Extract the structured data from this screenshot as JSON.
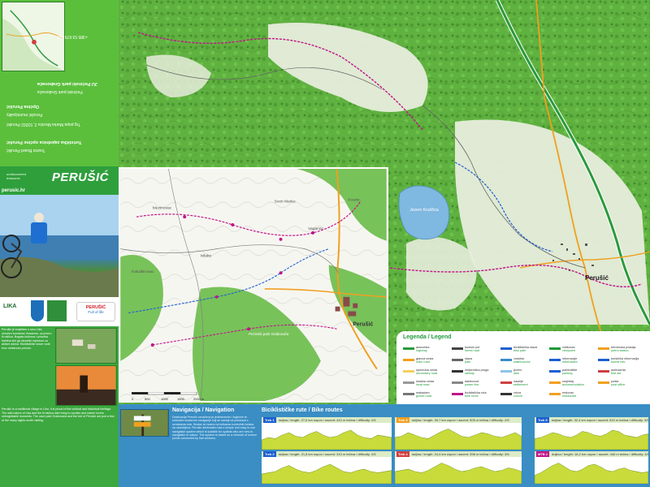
{
  "map": {
    "town_label": "Perušić",
    "lake_label": "Jezero Kruščica",
    "inset_town_label": "Perušić",
    "inset_places": [
      "Sveti Marko",
      "Kvarte",
      "Mezinovac",
      "Kaluđerovac",
      "Vaganac",
      "Mlaka"
    ],
    "inset_poi_label": "Pećinski park Grabovača"
  },
  "left_panel": {
    "brand": "PERUŠIĆ",
    "brand_sub": "undiscovered treasures",
    "url": "perusic.hr",
    "tourist_board": "Turistička zajednica općine Perušić",
    "tourist_board_en": "Tourist Board Perušić",
    "municipality": "Općina Perušić",
    "municipality_en": "Perušić municipality",
    "address": "Trg popa Marka Mesića 2, 53202 Perušić",
    "phone": "+385 53 679 188",
    "cave_park": "JU Pećinski park Grabovača",
    "cave_park_en": "Pećinski park Grabovača",
    "logo_1": "LIKA",
    "logo_2": "PERUŠIĆ",
    "logo_3_sub": "Full of life",
    "para_top": "Perušić je smješten u srcu Like, okružen šumama i livadama, uz jezero Kruščica. Bogata kulturna i prirodna baština čini ga idealnim mjestom za aktivni odmor. Biciklističke staze vode kroz netaknutu prirodu.",
    "para_bottom": "Perušić is a traditional village in Lika. It is proud of the cultural and historical heritage. The wild nature of Lika and the Kruščica lake bring to cyclists and nature lovers unforgettable moments. The cave park Grabovača and the fort of Perušić are just a few of the many sights worth visiting."
  },
  "legend": {
    "title": "Legenda / Legend",
    "items": [
      {
        "hr": "autocesta",
        "en": "highway",
        "color": "#2a9a3a"
      },
      {
        "hr": "glavna cesta",
        "en": "main road",
        "color": "#f0a020"
      },
      {
        "hr": "sporedna cesta",
        "en": "secondary road",
        "color": "#f5d060"
      },
      {
        "hr": "lokalna cesta",
        "en": "local road",
        "color": "#999999"
      },
      {
        "hr": "makadam",
        "en": "gravel road",
        "color": "#777777"
      },
      {
        "hr": "šumski put",
        "en": "forest road",
        "color": "#444444"
      },
      {
        "hr": "staza",
        "en": "path",
        "color": "#666666"
      },
      {
        "hr": "željeznička pruga",
        "en": "railway",
        "color": "#333333"
      },
      {
        "hr": "dalekovod",
        "en": "power line",
        "color": "#888888"
      },
      {
        "hr": "biciklistička ruta",
        "en": "bike route",
        "color": "#c0148a"
      },
      {
        "hr": "biciklistička staza",
        "en": "bike path",
        "color": "#1e5fd0"
      },
      {
        "hr": "vodotok",
        "en": "watercourse",
        "color": "#3a8ec4"
      },
      {
        "hr": "jezero",
        "en": "lake",
        "color": "#8fc3e6"
      },
      {
        "hr": "naselje",
        "en": "settlement",
        "color": "#d04040"
      },
      {
        "hr": "crkva",
        "en": "church",
        "color": "#333333"
      },
      {
        "hr": "vidikovac",
        "en": "viewpoint",
        "color": "#1d9a3a"
      },
      {
        "hr": "informacije",
        "en": "information",
        "color": "#1e5fd0"
      },
      {
        "hr": "parkiralište",
        "en": "parking",
        "color": "#1e5fd0"
      },
      {
        "hr": "smještaj",
        "en": "accommodation",
        "color": "#f0a020"
      },
      {
        "hr": "restoran",
        "en": "restaurant",
        "color": "#f0a020"
      },
      {
        "hr": "benzinska postaja",
        "en": "petrol station",
        "color": "#f0a020"
      },
      {
        "hr": "turistička informacija",
        "en": "tourist info",
        "color": "#1e5fd0"
      },
      {
        "hr": "ambulanta",
        "en": "first aid",
        "color": "#d04040"
      },
      {
        "hr": "pošta",
        "en": "post office",
        "color": "#f0a020"
      }
    ]
  },
  "navigation": {
    "title": "Navigacija / Navigation",
    "text": "Destinacija Perušić označena je jedinstvenim i logičnim te sloboden sustavom navigacije koji se sastoji od putokaza s oznakama ruta. Sustav se bazira na točkama kontrolnih točaka na raskrižjima. Perušić destination has a simple and easy to use navigation system which is suitable for cyclists who are new to navigation in nature. The system is based on a network of control points connected by trail sections."
  },
  "bike_routes": {
    "title": "Biciklističke rute / Bike routes",
    "tracks": [
      {
        "label": "Trek 1",
        "header": "duljina / length: 27,6 km  uspon / ascent: 410 m  težina / difficulty: 2/5",
        "color": "#1e5fd0",
        "profile": [
          0.4,
          0.5,
          0.45,
          0.6,
          0.7,
          0.55,
          0.5,
          0.65,
          0.75,
          0.6,
          0.5,
          0.55,
          0.7,
          0.8,
          0.6,
          0.5,
          0.45,
          0.6,
          0.55,
          0.5
        ]
      },
      {
        "label": "Trek 3",
        "header": "duljina / length: 30,7 km  uspon / ascent: 505 m  težina / difficulty: 2/5",
        "color": "#f0a020",
        "profile": [
          0.5,
          0.55,
          0.7,
          0.6,
          0.5,
          0.45,
          0.6,
          0.75,
          0.85,
          0.7,
          0.55,
          0.5,
          0.6,
          0.7,
          0.65,
          0.55,
          0.5,
          0.6,
          0.7,
          0.55
        ]
      },
      {
        "label": "Trek 5",
        "header": "duljina / length: 32,4 km  uspon / ascent: 510 m  težina / difficulty: 3/5",
        "color": "#1e5fd0",
        "profile": [
          0.45,
          0.5,
          0.6,
          0.7,
          0.65,
          0.55,
          0.5,
          0.6,
          0.75,
          0.7,
          0.6,
          0.55,
          0.65,
          0.8,
          0.75,
          0.6,
          0.55,
          0.5,
          0.6,
          0.65
        ]
      },
      {
        "label": "Trek 2",
        "header": "duljina / length: 21,8 km  uspon / ascent: 310 m  težina / difficulty: 2/5",
        "color": "#1e5fd0",
        "profile": [
          0.4,
          0.45,
          0.5,
          0.65,
          0.75,
          0.6,
          0.5,
          0.45,
          0.55,
          0.7,
          0.8,
          0.65,
          0.5,
          0.45,
          0.55,
          0.6,
          0.5,
          0.45,
          0.5,
          0.55
        ]
      },
      {
        "label": "Trek 4",
        "header": "duljina / length: 24,4 km  uspon / ascent: 398 m  težina / difficulty: 3/5",
        "color": "#d04040",
        "profile": [
          0.5,
          0.55,
          0.6,
          0.5,
          0.45,
          0.55,
          0.7,
          0.85,
          0.75,
          0.6,
          0.5,
          0.55,
          0.65,
          0.7,
          0.6,
          0.5,
          0.55,
          0.65,
          0.6,
          0.5
        ]
      },
      {
        "label": "MTB 2",
        "header": "duljina / length: 18,2 km  uspon / ascent: 440 m  težina / difficulty: 4/5",
        "color": "#c0148a",
        "profile": [
          0.35,
          0.45,
          0.6,
          0.75,
          0.85,
          0.7,
          0.55,
          0.5,
          0.6,
          0.75,
          0.8,
          0.7,
          0.55,
          0.5,
          0.6,
          0.65,
          0.55,
          0.5,
          0.45,
          0.5
        ]
      }
    ]
  },
  "scale": {
    "labels": [
      "0",
      "500",
      "1000",
      "1500",
      "2000 m"
    ]
  }
}
